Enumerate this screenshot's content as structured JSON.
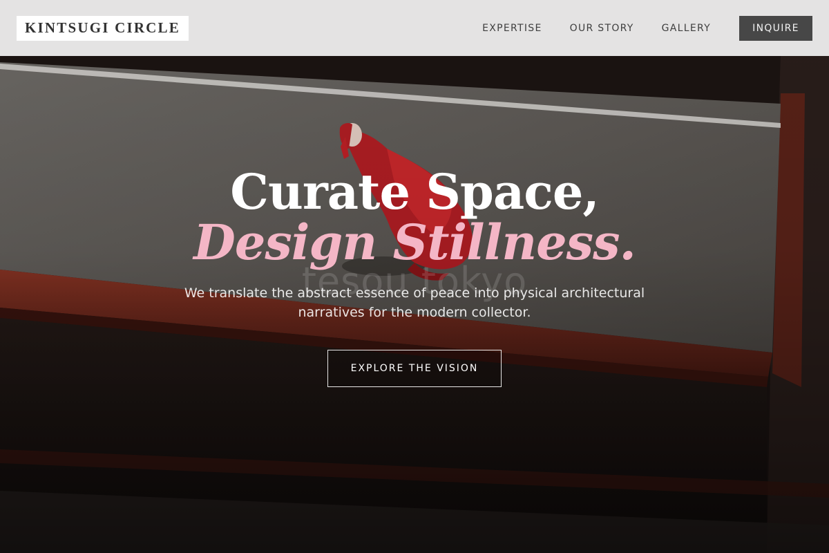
{
  "brand": {
    "logo_text": "KINTSUGI CIRCLE"
  },
  "nav": {
    "links": [
      "EXPERTISE",
      "OUR STORY",
      "GALLERY"
    ],
    "cta_label": "INQUIRE"
  },
  "hero": {
    "headline_line1": "Curate Space,",
    "headline_line2": "Design Stillness.",
    "image_watermark": "tesou tokyo",
    "subtext": "We translate the abstract essence of peace into physical architectural narratives for the modern collector.",
    "cta_label": "EXPLORE THE VISION"
  },
  "colors": {
    "accent_pink": "#f4b6c6",
    "header_bg": "#ececec",
    "inquire_bg": "#474747",
    "architecture_red": "#7e2c1e"
  }
}
